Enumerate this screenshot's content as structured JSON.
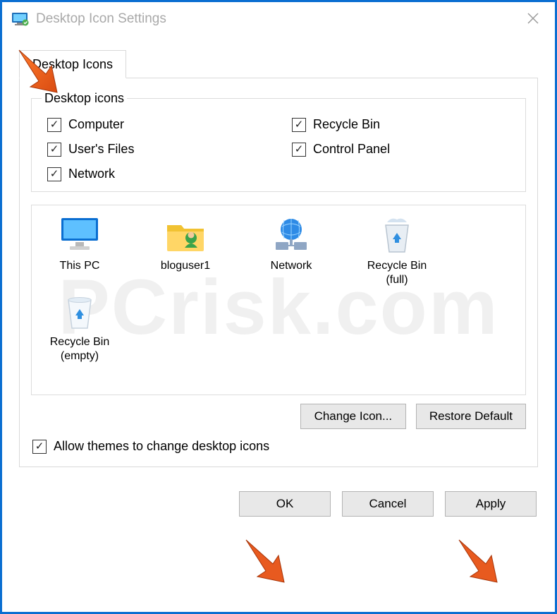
{
  "window": {
    "title": "Desktop Icon Settings",
    "tab_label": "Desktop Icons"
  },
  "group": {
    "legend": "Desktop icons",
    "checks": {
      "computer": {
        "label": "Computer",
        "checked": true
      },
      "recyclebin": {
        "label": "Recycle Bin",
        "checked": true
      },
      "userfiles": {
        "label": "User's Files",
        "checked": true
      },
      "controlpanel": {
        "label": "Control Panel",
        "checked": true
      },
      "network": {
        "label": "Network",
        "checked": true
      }
    }
  },
  "icons": {
    "thispc": "This PC",
    "user": "bloguser1",
    "network": "Network",
    "rb_full": "Recycle Bin (full)",
    "rb_empty": "Recycle Bin (empty)"
  },
  "buttons": {
    "change_icon": "Change Icon...",
    "restore_default": "Restore Default",
    "ok": "OK",
    "cancel": "Cancel",
    "apply": "Apply"
  },
  "allow_themes": {
    "label": "Allow themes to change desktop icons",
    "checked": true
  },
  "watermark": "PCrisk.com"
}
